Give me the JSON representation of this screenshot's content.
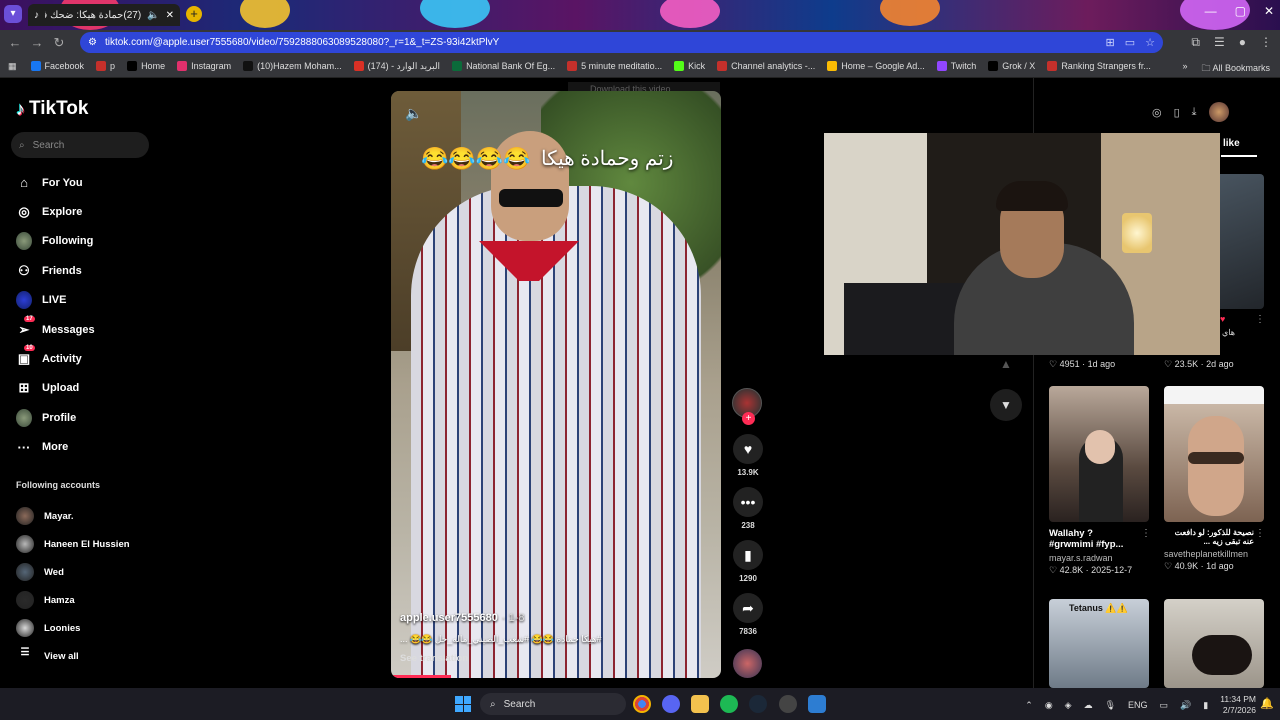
{
  "browser": {
    "tab_title": "(27)حمادة هيكا: ضحك في و...",
    "url": "tiktok.com/@apple.user7555680/video/7592888063089528080?_r=1&_t=ZS-93i42ktPlvY",
    "bookmarks": [
      {
        "label": "Facebook",
        "color": "#1877f2"
      },
      {
        "label": "p",
        "color": "#c4302b"
      },
      {
        "label": "Home",
        "color": "#000000"
      },
      {
        "label": "Instagram",
        "color": "#e1306c"
      },
      {
        "label": "(10)Hazem Moham...",
        "color": "#111111"
      },
      {
        "label": "(174) - البريد الوارد",
        "color": "#d93025"
      },
      {
        "label": "National Bank Of Eg...",
        "color": "#0b6b3a"
      },
      {
        "label": "5 minute meditatio...",
        "color": "#c4302b"
      },
      {
        "label": "Kick",
        "color": "#53fc18"
      },
      {
        "label": "Channel analytics -...",
        "color": "#c4302b"
      },
      {
        "label": "Home – Google Ad...",
        "color": "#fbbc04"
      },
      {
        "label": "Twitch",
        "color": "#9146ff"
      },
      {
        "label": "Grok / X",
        "color": "#000000"
      },
      {
        "label": "Ranking Strangers fr...",
        "color": "#c4302b"
      }
    ],
    "all_bookmarks": "All Bookmarks"
  },
  "tiktok": {
    "brand": "TikTok",
    "search_placeholder": "Search",
    "nav": [
      {
        "label": "For You",
        "icon": "home-icon"
      },
      {
        "label": "Explore",
        "icon": "compass-icon"
      },
      {
        "label": "Following",
        "icon": "avatar-icon"
      },
      {
        "label": "Friends",
        "icon": "friends-icon"
      },
      {
        "label": "LIVE",
        "icon": "live-icon"
      },
      {
        "label": "Messages",
        "icon": "send-icon",
        "badge": "17"
      },
      {
        "label": "Activity",
        "icon": "inbox-icon",
        "badge": "10"
      },
      {
        "label": "Upload",
        "icon": "plus-square-icon"
      },
      {
        "label": "Profile",
        "icon": "avatar-icon"
      },
      {
        "label": "More",
        "icon": "more-icon"
      }
    ],
    "following_accounts_title": "Following accounts",
    "following_accounts": [
      "Mayar.",
      "Haneen El Hussien",
      "Wed",
      "Hamza",
      "Loonies",
      "View all"
    ],
    "video": {
      "caption_overlay": "زتم وحمادة هيكا",
      "emoji_overlay": "😂😂😂😂",
      "author": "apple.user7555680",
      "date": "· 1-8",
      "description": "#هيكا حمادة 😂😂 #شعب_الصيني_ماله_حل 😂😂 ...",
      "see_translation": "See translation",
      "download_banner": "Download this video"
    },
    "actions": {
      "likes": "13.9K",
      "comments": "238",
      "saves": "1290",
      "shares": "7836"
    },
    "right_tab": "like",
    "grid": [
      {
        "title": "",
        "user": "",
        "likes": "4951",
        "ago": "1d ago"
      },
      {
        "title": "",
        "user": "",
        "likes": "23.5K",
        "ago": "2d ago"
      },
      {
        "title": "Wallahy ? #grwmimi #fyp...",
        "user": "mayar.s.radwan",
        "likes": "42.8K",
        "ago": "2025-12-7"
      },
      {
        "title": "نصيحة للذكور: لو دافعت عنه تبقى زيه ...",
        "user": "savetheplanetkillmen",
        "likes": "40.9K",
        "ago": "1d ago"
      },
      {
        "title": "Tetanus ⚠️⚠️",
        "user": "",
        "likes": "",
        "ago": ""
      }
    ],
    "grid_partial_caption": "هاي"
  },
  "taskbar": {
    "search": "Search",
    "lang": "ENG",
    "time": "11:34 PM",
    "date": "2/7/2026"
  }
}
